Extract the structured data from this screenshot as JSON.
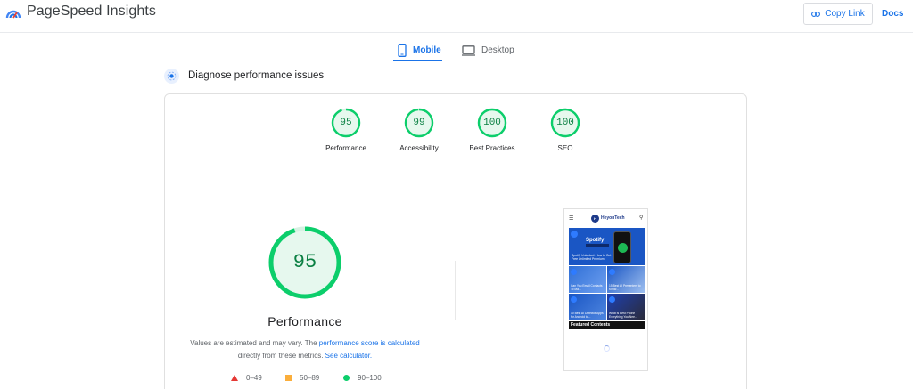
{
  "header": {
    "app_title": "PageSpeed Insights",
    "copy_link_label": "Copy Link",
    "docs_label": "Docs"
  },
  "tabs": [
    {
      "label": "Mobile",
      "active": true
    },
    {
      "label": "Desktop",
      "active": false
    }
  ],
  "diagnose": {
    "title": "Diagnose performance issues"
  },
  "scores": [
    {
      "label": "Performance",
      "value": "95"
    },
    {
      "label": "Accessibility",
      "value": "99"
    },
    {
      "label": "Best Practices",
      "value": "100"
    },
    {
      "label": "SEO",
      "value": "100"
    }
  ],
  "main_score": {
    "value": "95",
    "title": "Performance",
    "note_pre": "Values are estimated and may vary. The ",
    "note_link1": "performance score is calculated",
    "note_mid": " directly from these metrics. ",
    "note_link2": "See calculator."
  },
  "legend": [
    {
      "range": "0–49",
      "shape": "triangle",
      "color": "#e53935"
    },
    {
      "range": "50–89",
      "shape": "square",
      "color": "#fbae3b"
    },
    {
      "range": "90–100",
      "shape": "circle",
      "color": "#0cce6b"
    }
  ],
  "screenshot": {
    "site_name": "HeyonTech",
    "hero_label": "Spotify",
    "hero_caption": "Spotify Unlocked: How to Get Free Unlimited Premium",
    "tiles": [
      "Can You Email Contacts To Ma...",
      "15 Best AI Presenters to Know...",
      "10 Best AI Detector Apps for Android to...",
      "What Is Best Phone Everything You Nee..."
    ],
    "featured_label": "Featured Contents"
  },
  "colors": {
    "accent": "#1a73e8",
    "good": "#0cce6b",
    "good_text": "#0b8043"
  }
}
